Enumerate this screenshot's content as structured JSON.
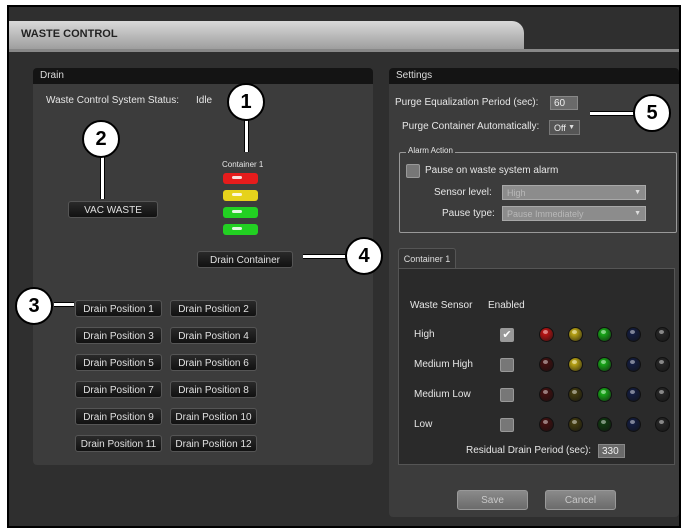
{
  "window": {
    "title": "WASTE CONTROL"
  },
  "drain": {
    "header": "Drain",
    "status_label": "Waste Control System Status:",
    "status_value": "Idle",
    "container_label": "Container 1",
    "vac_waste": "VAC WASTE",
    "drain_container": "Drain Container",
    "positions": [
      "Drain Position 1",
      "Drain Position 2",
      "Drain Position 3",
      "Drain Position 4",
      "Drain Position 5",
      "Drain Position 6",
      "Drain Position 7",
      "Drain Position 8",
      "Drain Position 9",
      "Drain Position 10",
      "Drain Position 11",
      "Drain Position 12"
    ],
    "led_colors": [
      "#e61c1c",
      "#e6d21c",
      "#22d022",
      "#22d022"
    ]
  },
  "settings": {
    "header": "Settings",
    "purge_period_label": "Purge Equalization Period (sec):",
    "purge_period_value": "60",
    "purge_auto_label": "Purge Container Automatically:",
    "purge_auto_value": "Off",
    "alarm_legend": "Alarm Action",
    "pause_label": "Pause on waste system alarm",
    "sensor_level_label": "Sensor level:",
    "sensor_level_value": "High",
    "pause_type_label": "Pause type:",
    "pause_type_value": "Pause Immediately",
    "tab": "Container 1",
    "col_sensor": "Waste Sensor",
    "col_enabled": "Enabled",
    "sensors": [
      {
        "name": "High",
        "enabled": true,
        "lit": [
          true,
          true,
          true,
          false,
          false
        ]
      },
      {
        "name": "Medium High",
        "enabled": false,
        "lit": [
          false,
          true,
          true,
          false,
          false
        ]
      },
      {
        "name": "Medium Low",
        "enabled": false,
        "lit": [
          false,
          false,
          true,
          false,
          false
        ]
      },
      {
        "name": "Low",
        "enabled": false,
        "lit": [
          false,
          false,
          false,
          false,
          false
        ]
      }
    ],
    "dot_colors": [
      "#d41414",
      "#d4bb14",
      "#18c018",
      "#1a2f8c",
      "#2a2a2a"
    ],
    "dot_colors_dim": [
      "#4a1010",
      "#4a4210",
      "#0f3f0f",
      "#141f48",
      "#2a2a2a"
    ],
    "residual_label": "Residual Drain Period (sec):",
    "residual_value": "330",
    "save": "Save",
    "cancel": "Cancel"
  },
  "callouts": [
    "1",
    "2",
    "3",
    "4",
    "5"
  ]
}
